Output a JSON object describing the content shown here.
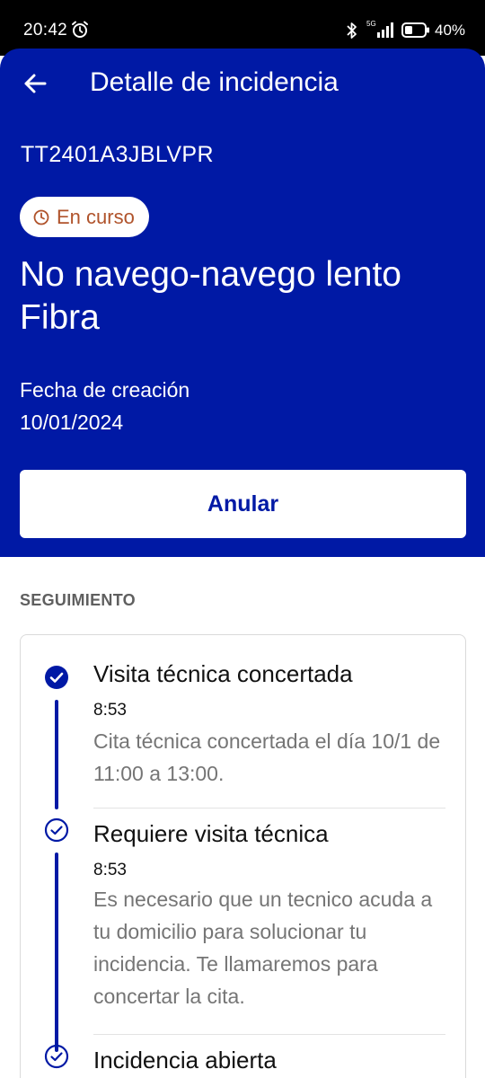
{
  "status_bar": {
    "time": "20:42",
    "network": "5G",
    "battery_pct": "40%",
    "battery_level": 0.4
  },
  "header": {
    "title": "Detalle de incidencia",
    "ticket_id": "TT2401A3JBLVPR",
    "status": "En curso",
    "issue_title": "No navego-navego lento Fibra",
    "created_label": "Fecha de creación",
    "created_date": "10/01/2024",
    "cancel_label": "Anular"
  },
  "tracking": {
    "section_title": "SEGUIMIENTO",
    "steps": [
      {
        "title": "Visita técnica concertada",
        "time": "8:53",
        "description": "Cita técnica concertada el día 10/1 de 11:00 a 13:00.",
        "state": "filled"
      },
      {
        "title": "Requiere visita técnica",
        "time": "8:53",
        "description": "Es necesario que un tecnico acuda a tu domicilio para solucionar tu incidencia. Te llamaremos para concertar la cita.",
        "state": "outline"
      },
      {
        "title": "Incidencia abierta",
        "state": "outline"
      }
    ]
  },
  "colors": {
    "brand_blue": "#0019a5",
    "status_text": "#b0532b",
    "muted_text": "#757575"
  }
}
